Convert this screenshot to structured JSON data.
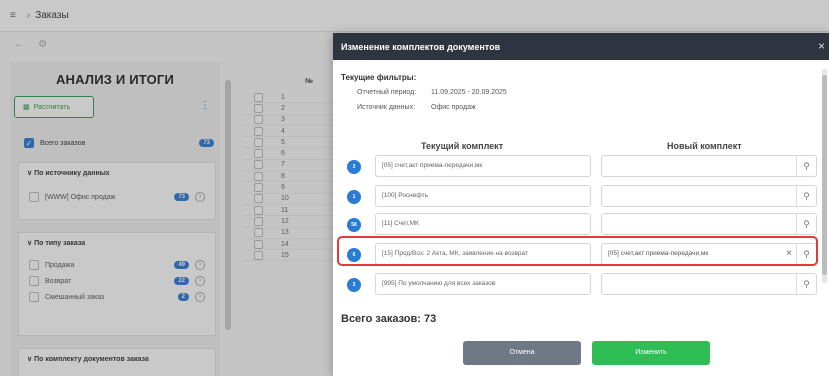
{
  "breadcrumb": {
    "current": "Заказы"
  },
  "left_panel": {
    "title": "АНАЛИЗ И ИТОГИ",
    "recalc_label": "Рассчитать",
    "all_orders": {
      "label": "Всего заказов",
      "count": "73"
    },
    "groups": [
      {
        "title": "По источнику данных",
        "items": [
          {
            "label": "[WWW] Офис продаж",
            "count": "73"
          }
        ]
      },
      {
        "title": "По типу заказа",
        "items": [
          {
            "label": "Продажа",
            "count": "49"
          },
          {
            "label": "Возврат",
            "count": "22"
          },
          {
            "label": "Смешанный заказ",
            "count": "2"
          }
        ]
      },
      {
        "title": "По комплекту документов заказа",
        "items": []
      }
    ]
  },
  "table": {
    "header": "№",
    "rows": [
      "1",
      "2",
      "3",
      "4",
      "5",
      "6",
      "7",
      "8",
      "9",
      "10",
      "11",
      "12",
      "13",
      "14",
      "15"
    ]
  },
  "modal": {
    "title": "Изменение комплектов документов",
    "filters_title": "Текущие фильтры:",
    "filters": [
      {
        "label": "Отчетный период:",
        "value": "11.09.2025 - 20.09.2025"
      },
      {
        "label": "Источник данных:",
        "value": "Офис продаж"
      }
    ],
    "col_current": "Текущий комплект",
    "col_new": "Новый комплект",
    "lines": [
      {
        "count": "3",
        "current": "[05] счет,акт приема-передачи,мк",
        "new": ""
      },
      {
        "count": "1",
        "current": "[100] Роснефть",
        "new": ""
      },
      {
        "count": "58",
        "current": "[11] Счет,МК",
        "new": ""
      },
      {
        "count": "6",
        "current": "[15] Прод/Воз: 2 Акта, МК, заявление на возврат",
        "new": "[05] счет,акт приема-передачи,мк"
      },
      {
        "count": "3",
        "current": "[995] По умолчанию для всех заказов",
        "new": ""
      }
    ],
    "total": "Всего заказов: 73",
    "cancel_label": "Отмена",
    "apply_label": "Изменить"
  }
}
